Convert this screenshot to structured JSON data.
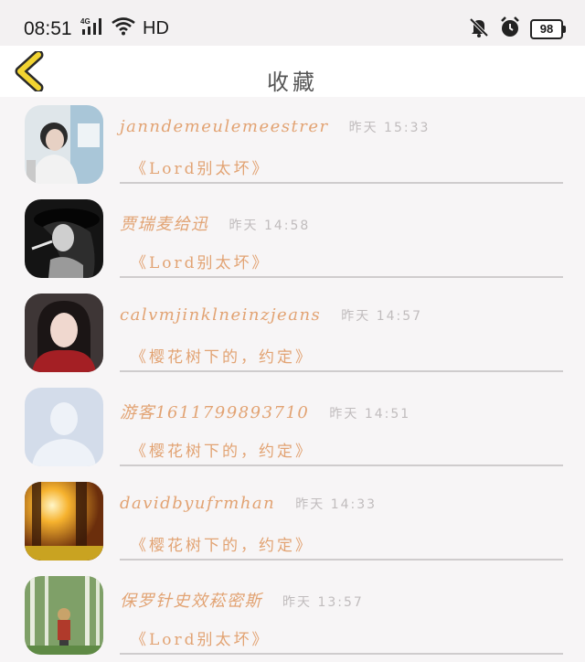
{
  "status_bar": {
    "time": "08:51",
    "network": "4G",
    "hd": "HD",
    "battery": "98"
  },
  "header": {
    "title": "收藏",
    "back_icon": "chevron-left-icon",
    "accent_color": "#f2d431"
  },
  "favorites": [
    {
      "user": "janndemeulemeestrer",
      "time": "昨天 15:33",
      "work": "《Lord别太坏》"
    },
    {
      "user": "贾瑞麦给迅",
      "time": "昨天 14:58",
      "work": "《Lord别太坏》"
    },
    {
      "user": "calvmjinklneinzjeans",
      "time": "昨天 14:57",
      "work": "《樱花树下的，约定》"
    },
    {
      "user": "游客1611799893710",
      "time": "昨天 14:51",
      "work": "《樱花树下的，约定》"
    },
    {
      "user": "davidbyufrmhan",
      "time": "昨天 14:33",
      "work": "《樱花树下的，约定》"
    },
    {
      "user": "保罗针史效菘密斯",
      "time": "昨天 13:57",
      "work": "《Lord别太坏》"
    }
  ],
  "colors": {
    "name_text": "#e2a373",
    "time_text": "#c0bcbd",
    "divider": "#cfcccd",
    "background": "#f7f5f6"
  }
}
